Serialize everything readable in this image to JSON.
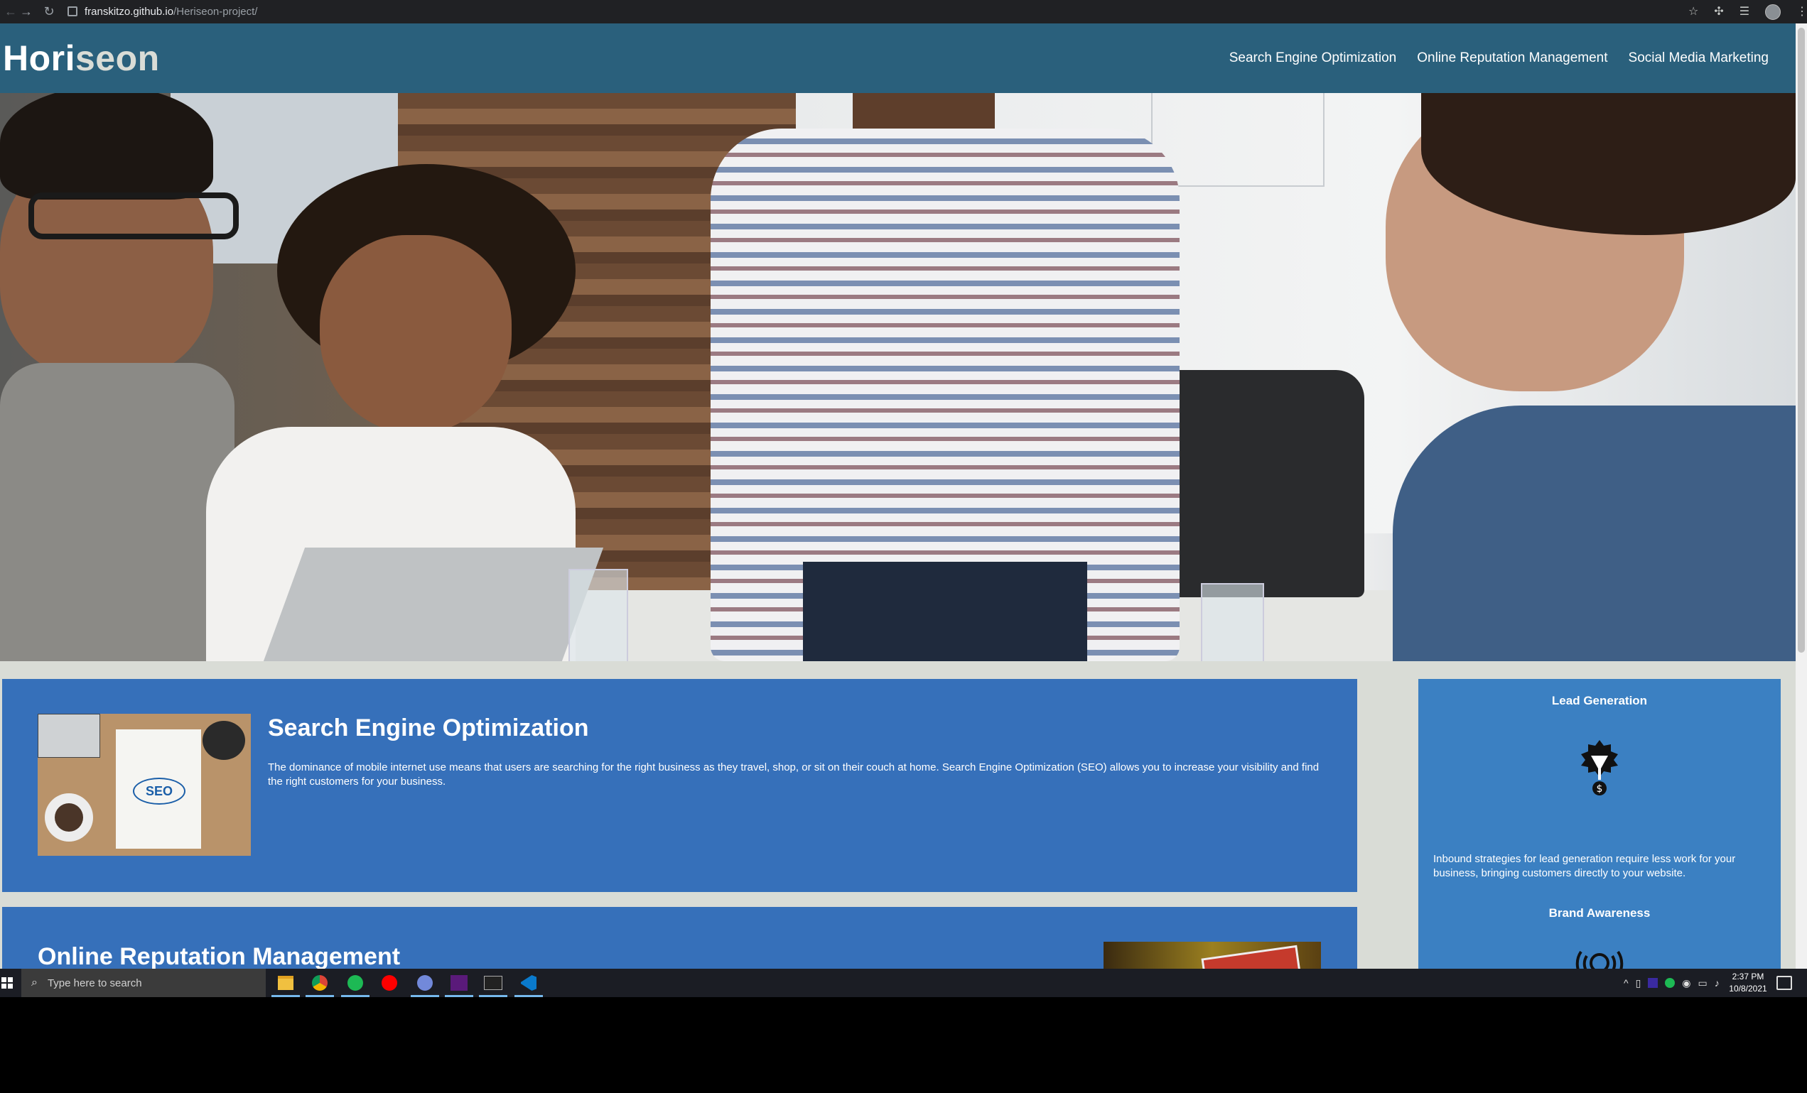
{
  "browser": {
    "url_host": "franskitzo.github.io",
    "url_path": "/Heriseon-project/"
  },
  "site": {
    "logo_part1": "Hori",
    "logo_part2": "seon",
    "nav": [
      {
        "label": "Search Engine Optimization"
      },
      {
        "label": "Online Reputation Management"
      },
      {
        "label": "Social Media Marketing"
      }
    ]
  },
  "content": {
    "seo": {
      "title": "Search Engine Optimization",
      "text": "The dominance of mobile internet use means that users are searching for the right business as they travel, shop, or sit on their couch at home. Search Engine Optimization (SEO) allows you to increase your visibility and find the right customers for your business.",
      "image_label": "SEO"
    },
    "orm": {
      "title": "Online Reputation Management"
    }
  },
  "benefits": {
    "lead": {
      "title": "Lead Generation",
      "text": "Inbound strategies for lead generation require less work for your business, bringing customers directly to your website."
    },
    "brand": {
      "title": "Brand Awareness"
    }
  },
  "taskbar": {
    "search_placeholder": "Type here to search",
    "time": "2:37 PM",
    "date": "10/8/2021"
  },
  "colors": {
    "header": "#2a607c",
    "card": "#3670ba",
    "aside": "#3b80c2",
    "page_bg": "#d9dcd6"
  }
}
